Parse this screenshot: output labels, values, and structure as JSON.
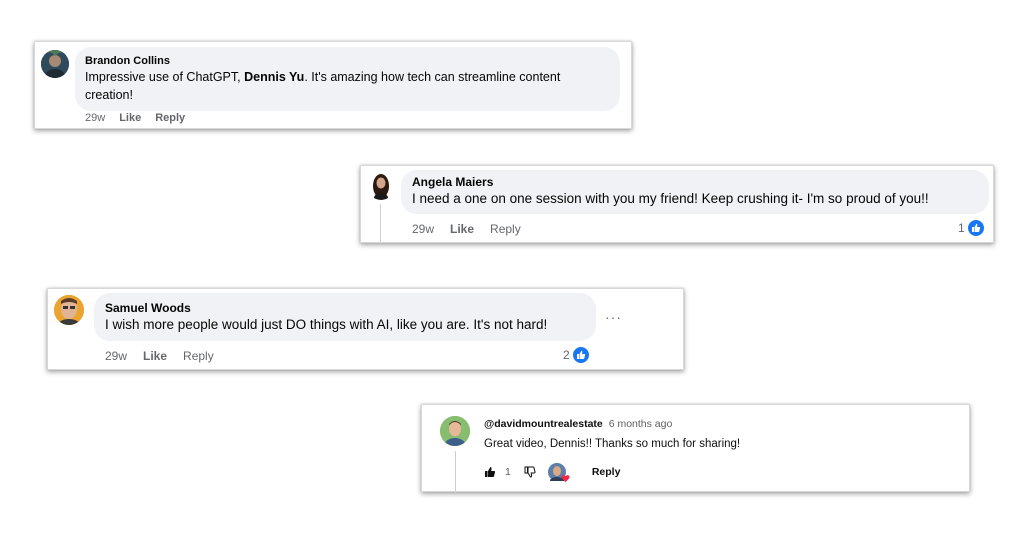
{
  "comments": [
    {
      "author": "Brandon Collins",
      "text_before": "Impressive use of ChatGPT, ",
      "mention": "Dennis Yu",
      "text_after": ". It's amazing how tech can streamline content",
      "text_line2": "creation!",
      "time": "29w",
      "like_label": "Like",
      "reply_label": "Reply"
    },
    {
      "author": "Angela Maiers",
      "text": "I need a one on one session with you my friend! Keep crushing it- I'm so proud of you!!",
      "time": "29w",
      "like_label": "Like",
      "reply_label": "Reply",
      "reactions": "1"
    },
    {
      "author": "Samuel Woods",
      "text": "I wish more people would just DO things with AI, like you are. It's not hard!",
      "time": "29w",
      "like_label": "Like",
      "reply_label": "Reply",
      "reactions": "2",
      "more_icon": "···"
    },
    {
      "author": "@davidmountrealestate",
      "time": "6 months ago",
      "text": "Great video, Dennis!! Thanks so much for sharing!",
      "likes": "1",
      "reply_label": "Reply"
    }
  ],
  "colors": {
    "bubble": "#f0f2f5",
    "like_blue": "#1877f2",
    "meta_gray": "#65676b",
    "heart_red": "#f02849"
  },
  "icons": [
    "like-icon",
    "thumbs-up-icon",
    "thumbs-down-icon",
    "heart-icon",
    "more-options-icon"
  ]
}
